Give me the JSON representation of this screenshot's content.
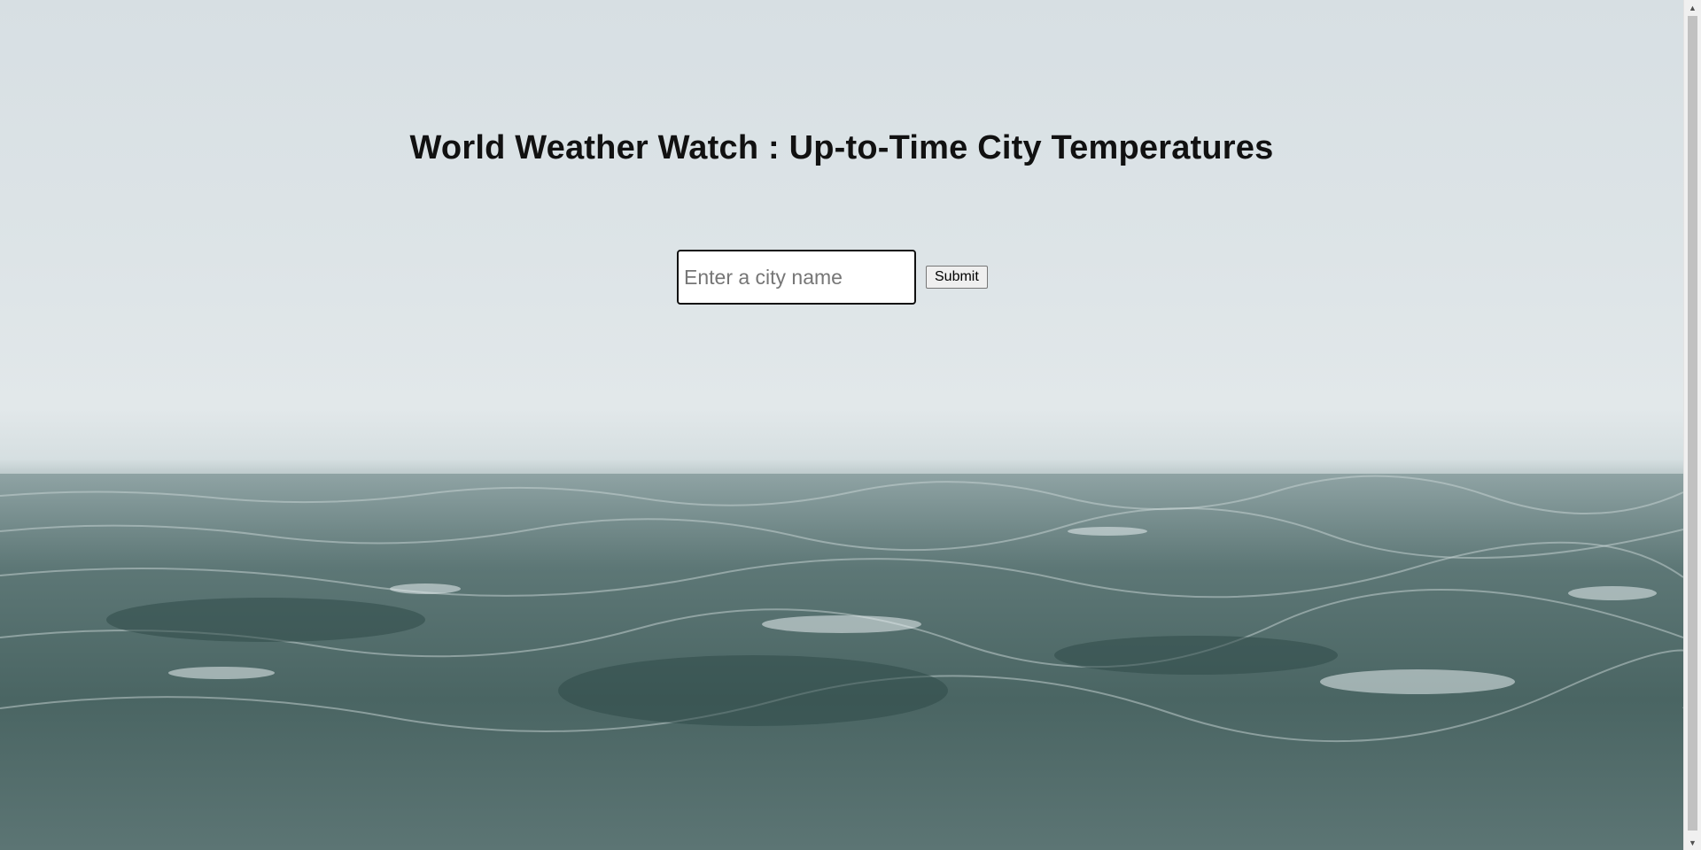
{
  "header": {
    "title": "World Weather Watch : Up-to-Time City Temperatures"
  },
  "search": {
    "placeholder": "Enter a city name",
    "value": "",
    "submit_label": "Submit"
  },
  "background": {
    "icon": "ocean-fog-image"
  },
  "colors": {
    "sky": "#dde4e7",
    "sea": "#56706f",
    "title_text": "#111111"
  }
}
